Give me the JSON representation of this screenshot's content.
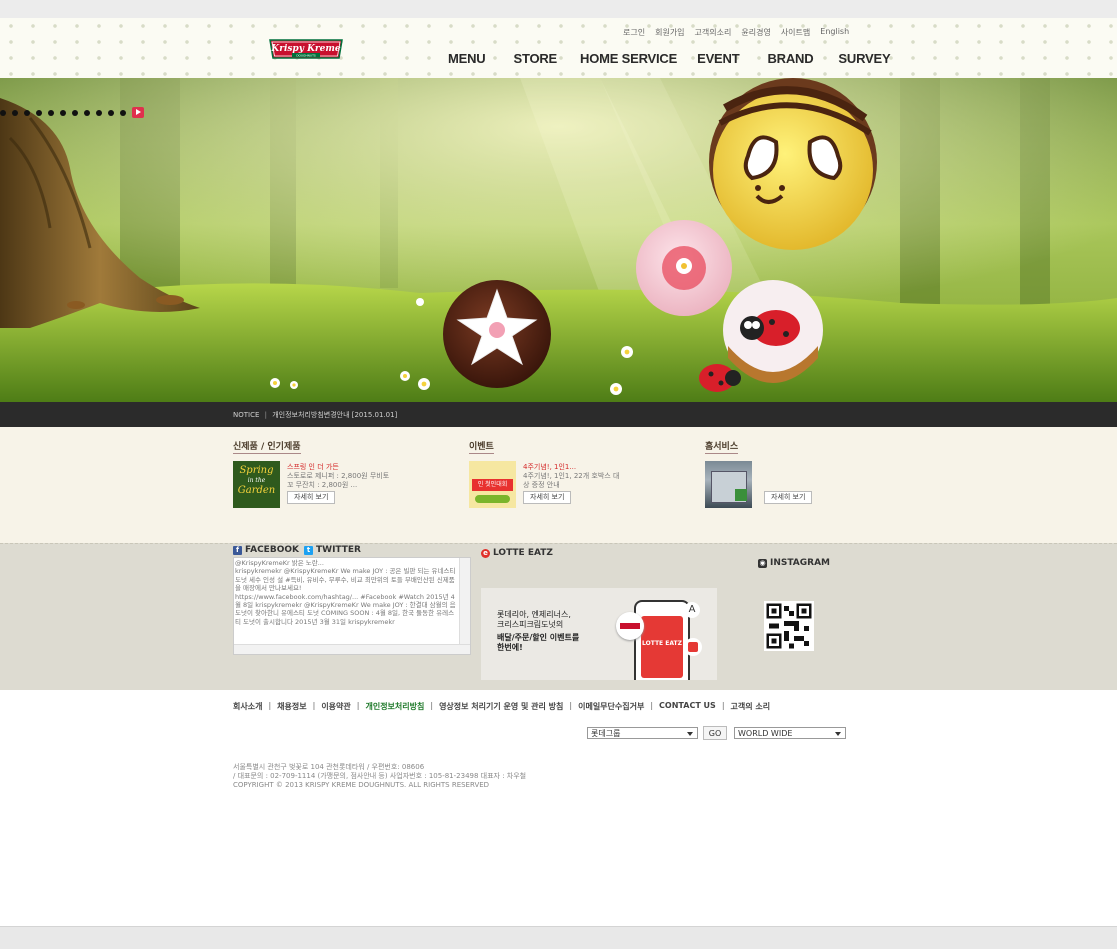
{
  "header": {
    "logo_text": "Krispy Kreme",
    "logo_sub": "DOUGHNUTS",
    "util_links": [
      "로그인",
      "회원가입",
      "고객의소리",
      "윤리경영",
      "사이트맵",
      "English"
    ],
    "nav": [
      "MENU",
      "STORE",
      "HOME SERVICE",
      "EVENT",
      "BRAND",
      "SURVEY"
    ]
  },
  "notice": {
    "label": "NOTICE",
    "text": "개인정보처리방침변경안내 [2015.01.01]"
  },
  "sections": {
    "new_menu": {
      "title": "신제품 / 인기제품",
      "thumb_text": [
        "Spring",
        "in the",
        "Garden"
      ],
      "headline": "스프링 인 더 가든",
      "line1": "스토로로 제니퍼 : 2,800원 무비토",
      "line2": "꼬 무잔치 : 2,800원 ...",
      "button": "자세히 보기"
    },
    "event": {
      "title": "이벤트",
      "thumb_text": "인 첫인대회",
      "headline": "4주기념!, 1인1...",
      "line1": "4주기념!, 1인1, 22개 호박스 대",
      "line2": "상 증정 안내",
      "button": "자세히 보기"
    },
    "service": {
      "title": "홈서비스",
      "button": "자세히 보기"
    }
  },
  "social": {
    "facebook_label": "FACEBOOK",
    "twitter_label": "TWITTER",
    "feed_text": "@KrispyKremeKr 밝은 노란...\nkrispykremekr @KrispyKremeKr We make JOY : 공은 빌판 되는 유네스티 도넛 세수 인성 설 #득비, 유비수, 무루수, 비교 최만위의 토들 부배인산된 신제품을 매장에서 만나보세요!\nhttps://www.facebook.com/hashtag/... #Facebook #Watch 2015년 4월 8일 krispykremekr @KrispyKremeKr We make JOY : 한결대 삼월의 음 도넛이 찾아한니 유에스티 도넛 COMING SOON : 4월 8일, 한국 둘동한 유레스 티 도넛이 출시합니다 2015년 3월 31일 krispykremekr",
    "lotte_label": "LOTTE EATZ",
    "lotte_lines": [
      "롯데리아, 엔제리너스,",
      "크리스피크림도넛의",
      "배달/주문/할인 이벤트를",
      "한번에!"
    ],
    "lotte_app_label": "LOTTE EATZ",
    "instagram_label": "INSTAGRAM"
  },
  "footer": {
    "links": [
      "회사소개",
      "채용정보",
      "이용약관",
      "개인정보처리방침",
      "영상정보 처리기기 운영 및 관리 방침",
      "이메일무단수집거부",
      "CONTACT US",
      "고객의 소리"
    ],
    "group_select": "롯데그룹",
    "go_button": "GO",
    "world_select": "WORLD WIDE",
    "address_lines": [
      "서울특별시 관천구 벚꽃로 104 관천롯데타워 / 우편번호: 08606",
      "/ 대표문의 : 02-709-1114 (가맹문의, 점사안내 등) 사업자번호 : 105-81-23498 대표자 : 차우철",
      "COPYRIGHT © 2013 KRISPY KREME DOUGHNUTS. ALL RIGHTS RESERVED"
    ]
  },
  "colors": {
    "brand_red": "#c8102e",
    "brand_green": "#00703c",
    "notice_bg": "#2b2b2b",
    "news_bg": "#f7f3e8",
    "social_bg": "#dddbd1",
    "highlight_link": "#1f7a2a"
  }
}
